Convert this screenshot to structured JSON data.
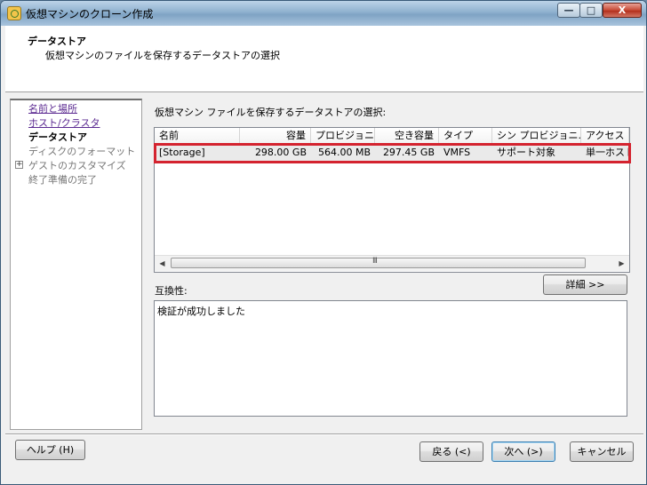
{
  "window": {
    "title": "仮想マシンのクローン作成",
    "minimize_glyph": "—",
    "maximize_glyph": "□",
    "close_glyph": "X"
  },
  "header": {
    "title": "データストア",
    "subtitle": "仮想マシンのファイルを保存するデータストアの選択"
  },
  "sidebar": {
    "items": [
      {
        "label": "名前と場所"
      },
      {
        "label": "ホスト/クラスタ"
      },
      {
        "label": "データストア"
      },
      {
        "label": "ディスクのフォーマット"
      },
      {
        "label": "ゲストのカスタマイズ",
        "expander": "+"
      },
      {
        "label": "終了準備の完了"
      }
    ]
  },
  "main": {
    "prompt": "仮想マシン ファイルを保存するデータストアの選択:",
    "columns": [
      "名前",
      "容量",
      "プロビジョニ...",
      "空き容量",
      "タイプ",
      "シン プロビジョニ...",
      "アクセス"
    ],
    "rows": [
      {
        "name": "[Storage]",
        "capacity": "298.00 GB",
        "provisioned": "564.00 MB",
        "free": "297.45 GB",
        "type": "VMFS",
        "thin": "サポート対象",
        "access": "単一ホスト"
      }
    ],
    "scroll_grip": "III",
    "compat_label": "互換性:",
    "details_button": "詳細 >>",
    "message": "検証が成功しました"
  },
  "footer": {
    "help": "ヘルプ (H)",
    "back": "戻る (<)",
    "next": "次へ (>)",
    "cancel": "キャンセル"
  }
}
